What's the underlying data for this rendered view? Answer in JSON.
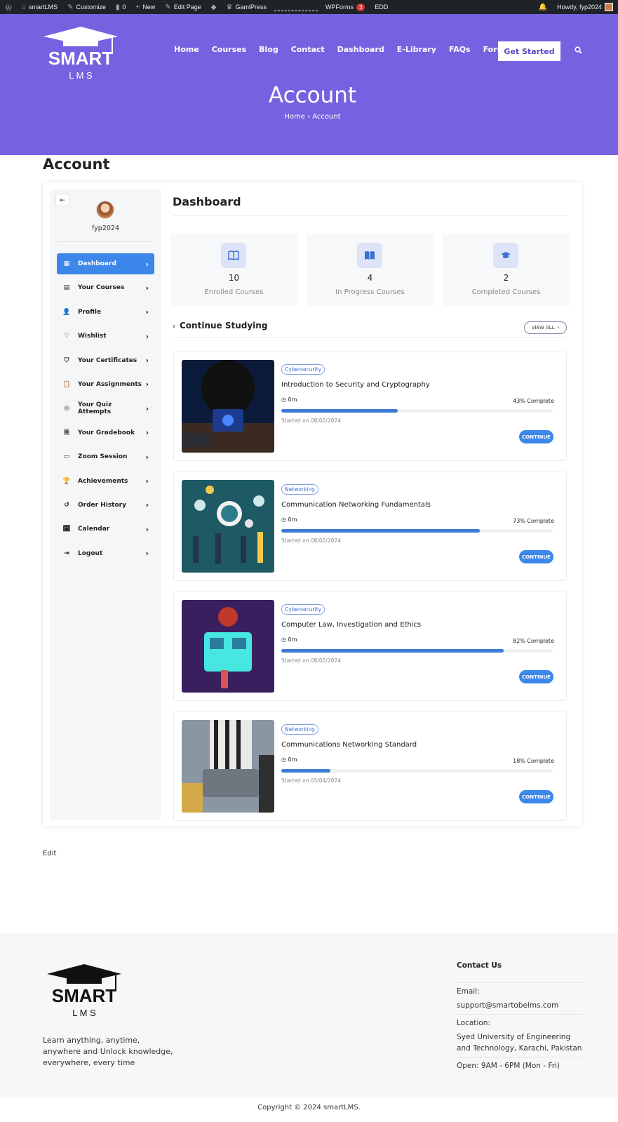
{
  "admin_bar": {
    "site": "smartLMS",
    "customize": "Customize",
    "comments": "0",
    "new": "New",
    "edit_page": "Edit Page",
    "gamipress": "GamiPress",
    "wpforms": "WPForms",
    "wpforms_count": "3",
    "edd": "EDD",
    "howdy": "Howdy, fyp2024"
  },
  "header": {
    "logo_main": "SMART",
    "logo_sub": "L M S",
    "nav": [
      "Home",
      "Courses",
      "Blog",
      "Contact",
      "Dashboard",
      "E-Library",
      "FAQs",
      "Forum"
    ],
    "cta": "Get Started",
    "title": "Account",
    "breadcrumb_home": "Home",
    "breadcrumb_sep": "›",
    "breadcrumb_current": "Account"
  },
  "page_heading": "Account",
  "sidebar": {
    "username": "fyp2024",
    "items": [
      {
        "label": "Dashboard",
        "icon": "grid-icon",
        "glyph": "▦"
      },
      {
        "label": "Your Courses",
        "icon": "book-icon",
        "glyph": "▤"
      },
      {
        "label": "Profile",
        "icon": "user-icon",
        "glyph": "👤"
      },
      {
        "label": "Wishlist",
        "icon": "heart-icon",
        "glyph": "♡"
      },
      {
        "label": "Your Certificates",
        "icon": "shield-icon",
        "glyph": "⛉"
      },
      {
        "label": "Your Assignments",
        "icon": "clipboard-icon",
        "glyph": "📋"
      },
      {
        "label": "Your Quiz Attempts",
        "icon": "target-icon",
        "glyph": "◎"
      },
      {
        "label": "Your Gradebook",
        "icon": "file-icon",
        "glyph": "🗎"
      },
      {
        "label": "Zoom Session",
        "icon": "video-icon",
        "glyph": "▭"
      },
      {
        "label": "Achievements",
        "icon": "trophy-icon",
        "glyph": "🏆"
      },
      {
        "label": "Order History",
        "icon": "history-icon",
        "glyph": "↺"
      },
      {
        "label": "Calendar",
        "icon": "calendar-icon",
        "glyph": "🗓"
      },
      {
        "label": "Logout",
        "icon": "logout-icon",
        "glyph": "⇥"
      }
    ]
  },
  "dashboard": {
    "title": "Dashboard",
    "stats": [
      {
        "value": "10",
        "label": "Enrolled Courses",
        "icon": "open-book-icon"
      },
      {
        "value": "4",
        "label": "In Progress Courses",
        "icon": "reading-book-icon"
      },
      {
        "value": "2",
        "label": "Completed Courses",
        "icon": "graduation-cap-icon"
      }
    ],
    "continue_heading": "Continue Studying",
    "view_all": "VIEW ALL",
    "courses": [
      {
        "category": "Cybersecurity",
        "title": "Introduction to Security and Cryptography",
        "time": "0m",
        "percent": 43,
        "percent_label": "43% Complete",
        "started": "Started on 08/02/2024",
        "button": "CONTINUE"
      },
      {
        "category": "Networking",
        "title": "Communication Networking Fundamentals",
        "time": "0m",
        "percent": 73,
        "percent_label": "73% Complete",
        "started": "Started on 08/02/2024",
        "button": "CONTINUE"
      },
      {
        "category": "Cybersecurity",
        "title": "Computer Law, Investigation and Ethics",
        "time": "0m",
        "percent": 82,
        "percent_label": "82% Complete",
        "started": "Started on 08/02/2024",
        "button": "CONTINUE"
      },
      {
        "category": "Networking",
        "title": "Communications Networking Standard",
        "time": "0m",
        "percent": 18,
        "percent_label": "18% Complete",
        "started": "Started on 05/04/2024",
        "button": "CONTINUE"
      }
    ]
  },
  "edit_link": "Edit",
  "footer": {
    "tagline": "Learn anything, anytime, anywhere and Unlock knowledge, everywhere, every time",
    "contact_heading": "Contact Us",
    "email_label": "Email:",
    "email": "support@smartobelms.com",
    "location_label": "Location:",
    "location": "Syed University of Engineering and Technology, Karachi, Pakistan",
    "hours": "Open: 9AM - 6PM (Mon - Fri)",
    "copyright": "Copyright © 2024 smartLMS."
  },
  "colors": {
    "brand_purple": "#7562e0",
    "accent_blue": "#3d86ea",
    "progress_blue": "#3b7dd1"
  }
}
